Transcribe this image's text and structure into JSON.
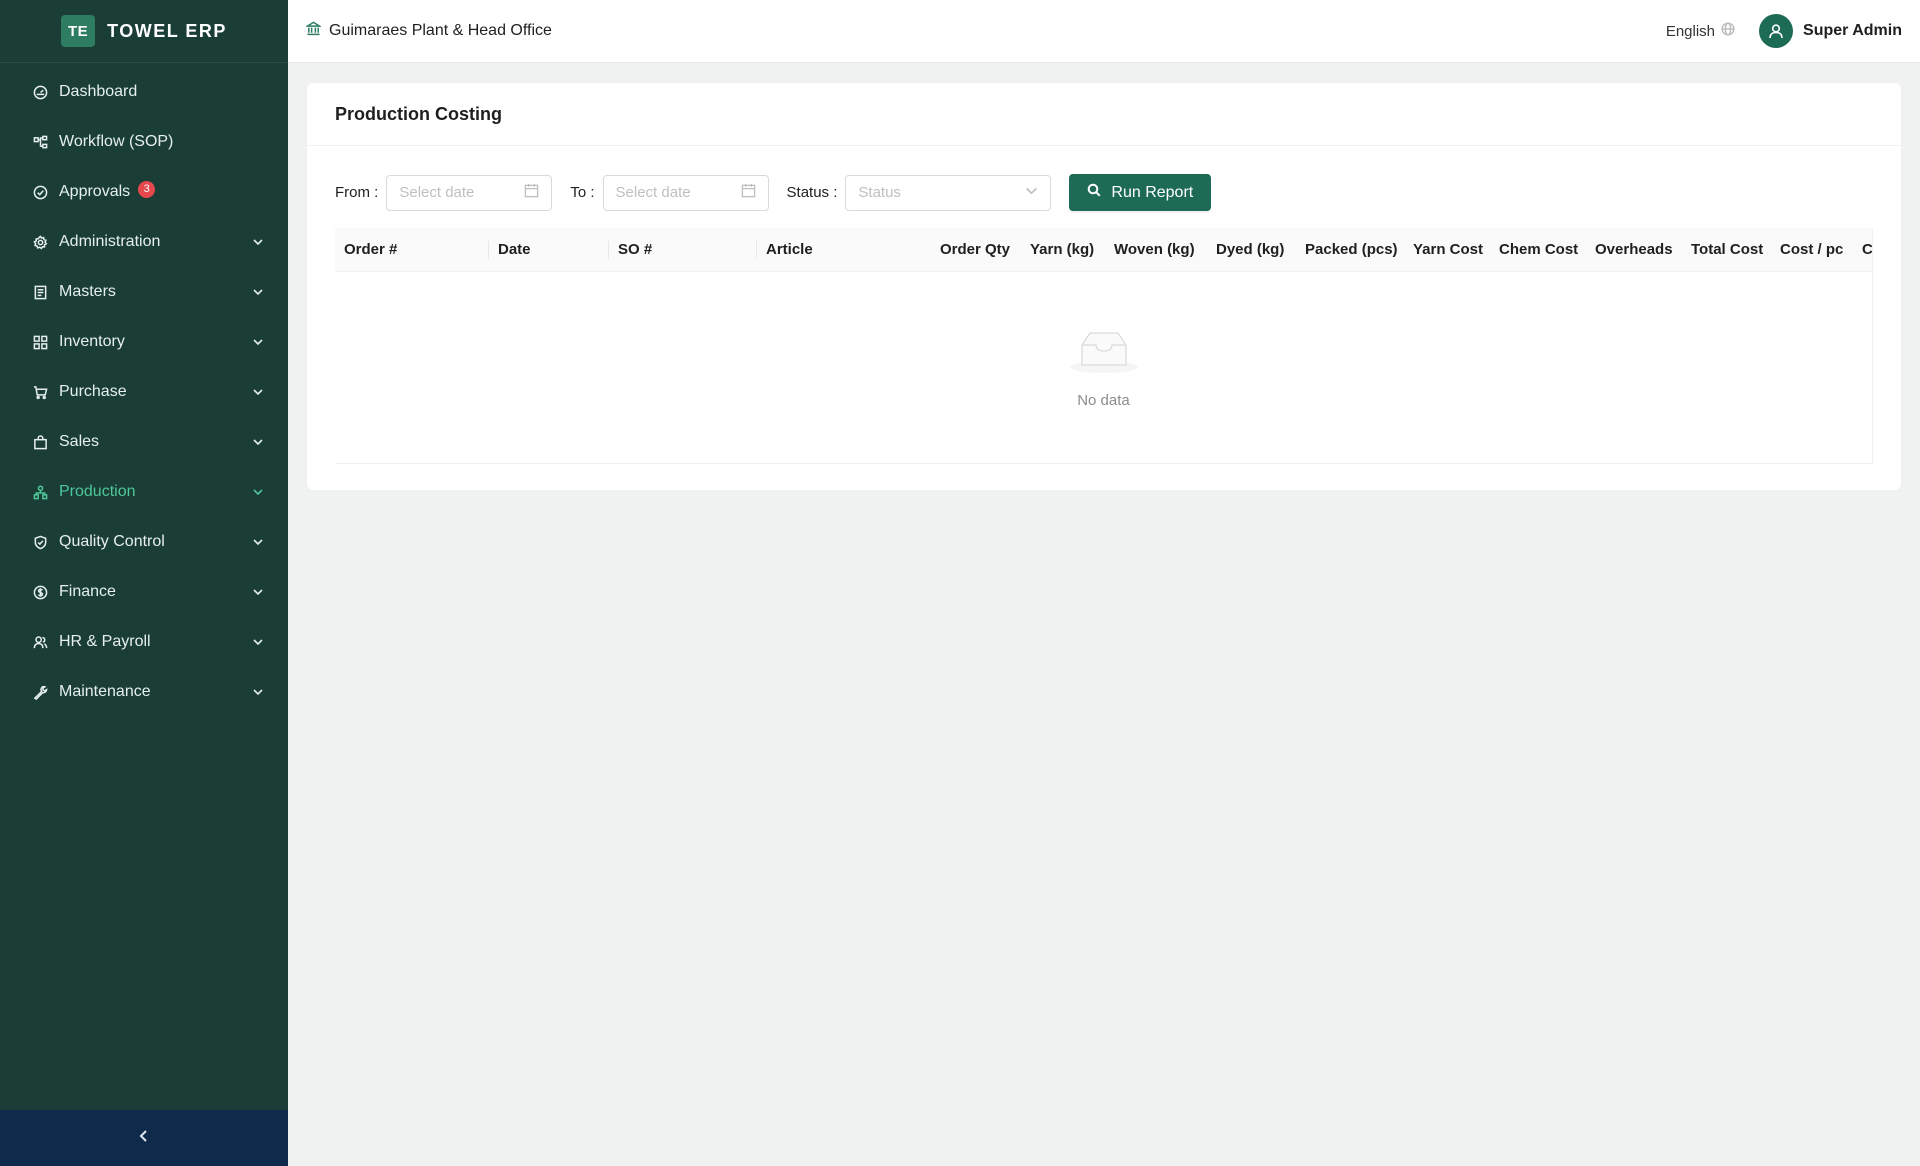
{
  "brand": {
    "logo_text": "TE",
    "name": "TOWEL ERP"
  },
  "sidebar": {
    "items": [
      {
        "label": "Dashboard",
        "icon": "dashboard-icon",
        "has_children": false
      },
      {
        "label": "Workflow (SOP)",
        "icon": "workflow-icon",
        "has_children": false
      },
      {
        "label": "Approvals",
        "icon": "check-circle-icon",
        "has_children": false,
        "badge": "3"
      },
      {
        "label": "Administration",
        "icon": "gear-icon",
        "has_children": true
      },
      {
        "label": "Masters",
        "icon": "book-icon",
        "has_children": true
      },
      {
        "label": "Inventory",
        "icon": "grid-icon",
        "has_children": true
      },
      {
        "label": "Purchase",
        "icon": "cart-icon",
        "has_children": true
      },
      {
        "label": "Sales",
        "icon": "bag-icon",
        "has_children": true
      },
      {
        "label": "Production",
        "icon": "cluster-icon",
        "has_children": true,
        "active": true
      },
      {
        "label": "Quality Control",
        "icon": "shield-check-icon",
        "has_children": true
      },
      {
        "label": "Finance",
        "icon": "dollar-circle-icon",
        "has_children": true
      },
      {
        "label": "HR & Payroll",
        "icon": "users-icon",
        "has_children": true
      },
      {
        "label": "Maintenance",
        "icon": "tool-icon",
        "has_children": true
      }
    ],
    "collapse_icon": "chevron-left-icon"
  },
  "header": {
    "company": "Guimaraes Plant & Head Office",
    "language": "English",
    "user": "Super Admin"
  },
  "page": {
    "title": "Production Costing",
    "filters": {
      "from_label": "From",
      "from_placeholder": "Select date",
      "to_label": "To",
      "to_placeholder": "Select date",
      "status_label": "Status",
      "status_placeholder": "Status",
      "run_label": "Run Report"
    },
    "table": {
      "columns": [
        "Order #",
        "Date",
        "SO #",
        "Article",
        "Order Qty",
        "Yarn (kg)",
        "Woven (kg)",
        "Dyed (kg)",
        "Packed (pcs)",
        "Yarn Cost",
        "Chem Cost",
        "Overheads",
        "Total Cost",
        "Cost / pc",
        "C"
      ],
      "rows": [],
      "empty_text": "No data"
    }
  },
  "colors": {
    "sidebar_bg": "#1a3e36",
    "accent": "#1e6b55",
    "active_nav": "#4fc79a",
    "badge": "#e5484d",
    "collapse_bar": "#0f2a4a"
  }
}
